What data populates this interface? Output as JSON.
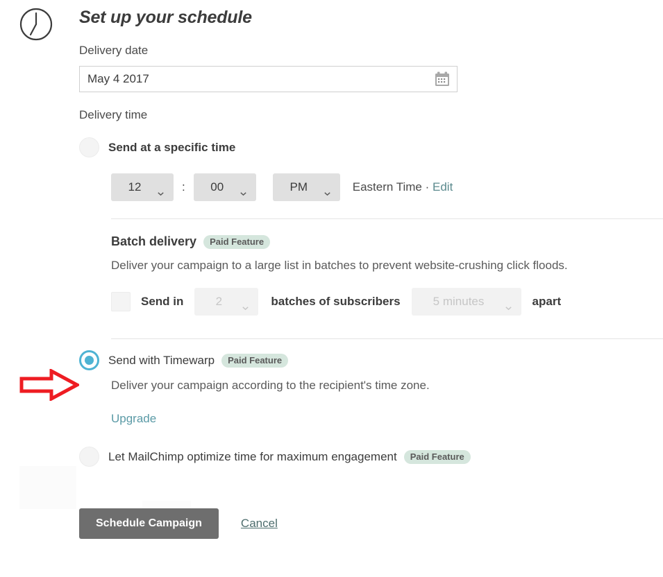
{
  "header": {
    "title": "Set up your schedule",
    "icon": "clock-icon"
  },
  "delivery_date": {
    "label": "Delivery date",
    "value": "May 4 2017",
    "placeholder": "May 4 2017",
    "icon": "calendar-icon"
  },
  "delivery_time": {
    "label": "Delivery time",
    "specific_time": {
      "option_label": "Send at a specific time",
      "selected": false,
      "hour": "12",
      "minute": "00",
      "meridiem": "PM",
      "colon": ":",
      "timezone_text": "Eastern Time · ",
      "timezone_name": "Eastern Time",
      "separator": " · ",
      "edit_label": "Edit"
    },
    "batch_delivery": {
      "title": "Batch delivery",
      "badge": "Paid Feature",
      "description": "Deliver your campaign to a large list in batches to prevent website-crushing click floods.",
      "checked": false,
      "send_in_label": "Send in",
      "batches_value": "2",
      "batches_of_label": "batches of subscribers",
      "interval_value": "5 minutes",
      "apart_label": "apart"
    },
    "timewarp": {
      "option_label": "Send with Timewarp",
      "badge": "Paid Feature",
      "description": "Deliver your campaign according to the recipient's time zone.",
      "selected": true,
      "upgrade_label": "Upgrade"
    },
    "optimize": {
      "option_label": "Let MailChimp optimize time for maximum engagement",
      "badge": "Paid Feature",
      "selected": false
    }
  },
  "actions": {
    "submit_label": "Schedule Campaign",
    "cancel_label": "Cancel"
  },
  "annotation": {
    "arrow": "red-arrow-right",
    "color": "#ee1c22"
  },
  "colors": {
    "accent_teal": "#4eb3d3",
    "badge_bg": "#d5e6dd",
    "link": "#5a9aa6",
    "button_bg": "#6e6e6e",
    "text": "#3c3c3c",
    "rule": "#e4e4e4"
  }
}
